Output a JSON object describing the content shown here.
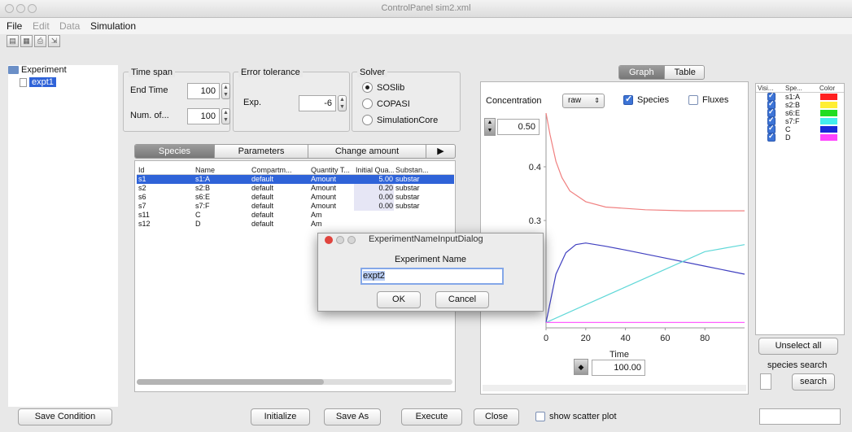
{
  "window": {
    "title": "ControlPanel sim2.xml"
  },
  "menu": {
    "file": "File",
    "edit": "Edit",
    "data": "Data",
    "simulation": "Simulation"
  },
  "toolbar": {
    "icons": [
      "open-icon",
      "save-icon",
      "print-icon",
      "export-icon"
    ]
  },
  "tree": {
    "root": "Experiment",
    "child": "expt1"
  },
  "time_span": {
    "title": "Time span",
    "end_time_label": "End Time",
    "end_time_value": "100",
    "num_label": "Num. of...",
    "num_value": "100"
  },
  "error_tolerance": {
    "title": "Error tolerance",
    "exp_label": "Exp.",
    "exp_value": "-6"
  },
  "solver": {
    "title": "Solver",
    "options": [
      "SOSlib",
      "COPASI",
      "SimulationCore"
    ],
    "selected": "SOSlib"
  },
  "tabs": {
    "species": "Species",
    "parameters": "Parameters",
    "change_amount": "Change amount",
    "more": "▶"
  },
  "species_table": {
    "headers": [
      "Id",
      "Name",
      "Compartm...",
      "Quantity T...",
      "Initial Qua...",
      "Substan..."
    ],
    "rows": [
      [
        "s1",
        "s1:A",
        "default",
        "Amount",
        "5.00",
        "substar"
      ],
      [
        "s2",
        "s2:B",
        "default",
        "Amount",
        "0.20",
        "substar"
      ],
      [
        "s6",
        "s6:E",
        "default",
        "Amount",
        "0.00",
        "substar"
      ],
      [
        "s7",
        "s7:F",
        "default",
        "Amount",
        "0.00",
        "substar"
      ],
      [
        "s11",
        "C",
        "default",
        "Am",
        "",
        ""
      ],
      [
        "s12",
        "D",
        "default",
        "Am",
        "",
        ""
      ]
    ]
  },
  "graph_tabs": {
    "graph": "Graph",
    "table": "Table"
  },
  "graph_controls": {
    "concentration_label": "Concentration",
    "mode": "raw",
    "species_label": "Species",
    "fluxes_label": "Fluxes",
    "ymax_value": "0.50",
    "xmax_value": "100.00"
  },
  "chart_data": {
    "type": "line",
    "xlabel": "Time",
    "ylabel": "",
    "xlim": [
      0,
      100
    ],
    "ylim": [
      0.1,
      0.5
    ],
    "x_ticks": [
      "0",
      "20",
      "40",
      "60",
      "80"
    ],
    "y_ticks": [
      "0.4",
      "0.3"
    ],
    "series": [
      {
        "name": "s1:A",
        "color": "#f08080",
        "x": [
          0,
          2,
          5,
          8,
          12,
          20,
          30,
          50,
          70,
          100
        ],
        "y": [
          0.5,
          0.46,
          0.41,
          0.38,
          0.355,
          0.335,
          0.325,
          0.32,
          0.318,
          0.318
        ]
      },
      {
        "name": "C",
        "color": "#4040c0",
        "x": [
          0,
          5,
          10,
          15,
          20,
          30,
          40,
          60,
          80,
          100
        ],
        "y": [
          0.11,
          0.2,
          0.24,
          0.255,
          0.258,
          0.252,
          0.245,
          0.23,
          0.215,
          0.2
        ]
      },
      {
        "name": "s7:F",
        "color": "#60d8d8",
        "x": [
          0,
          20,
          40,
          60,
          80,
          100
        ],
        "y": [
          0.11,
          0.143,
          0.176,
          0.209,
          0.242,
          0.255
        ]
      },
      {
        "name": "D",
        "color": "#ff60ff",
        "x": [
          0,
          100
        ],
        "y": [
          0.11,
          0.11
        ]
      }
    ]
  },
  "legend": {
    "headers": [
      "Visi...",
      "Spe...",
      "Color"
    ],
    "rows": [
      {
        "name": "s1:A",
        "color": "#ff2020"
      },
      {
        "name": "s2:B",
        "color": "#ffee33"
      },
      {
        "name": "s6:E",
        "color": "#22dd22"
      },
      {
        "name": "s7:F",
        "color": "#44eeee"
      },
      {
        "name": "C",
        "color": "#1a2ad8"
      },
      {
        "name": "D",
        "color": "#ff44ff"
      }
    ]
  },
  "side_controls": {
    "unselect_all": "Unselect all",
    "species_search_label": "species search",
    "search_button": "search"
  },
  "bottom": {
    "save_condition": "Save Condition",
    "initialize": "Initialize",
    "save_as": "Save As",
    "execute": "Execute",
    "close": "Close",
    "show_scatter": "show scatter plot"
  },
  "dialog": {
    "title": "ExperimentNameInputDialog",
    "label": "Experiment Name",
    "value": "expt2",
    "ok": "OK",
    "cancel": "Cancel"
  }
}
